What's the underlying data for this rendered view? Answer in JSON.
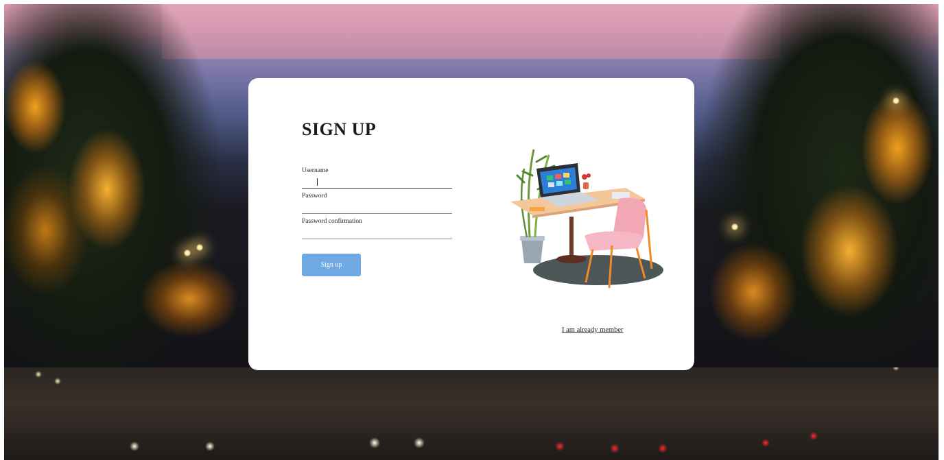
{
  "form": {
    "title": "SIGN UP",
    "username_label": "Username",
    "username_value": "",
    "password_label": "Password",
    "password_value": "",
    "password_confirmation_label": "Password confirmation",
    "password_confirmation_value": "",
    "submit_label": "Sign up",
    "member_link": "I am already member"
  },
  "colors": {
    "button": "#6fa9e3",
    "card": "#ffffff"
  },
  "illustration": {
    "icon": "desk-workspace-illustration"
  }
}
